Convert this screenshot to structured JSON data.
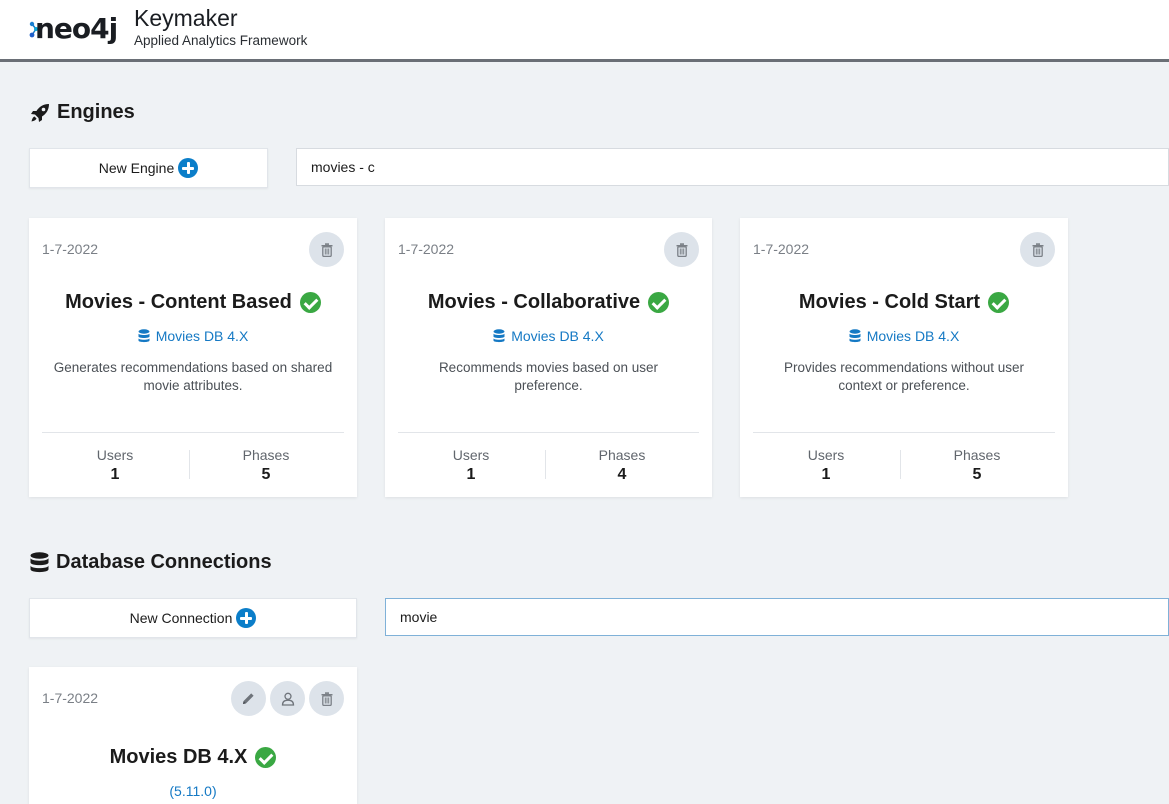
{
  "header": {
    "logo_text": "neo4j",
    "app_title": "Keymaker",
    "app_subtitle": "Applied Analytics Framework"
  },
  "engines": {
    "section_title": "Engines",
    "section_icon": "rocket-icon",
    "new_label": "New Engine",
    "search_value": "movies - c",
    "cards": [
      {
        "date": "1-7-2022",
        "title": "Movies - Content Based",
        "db": "Movies DB 4.X",
        "description": "Generates recommendations based on shared movie attributes.",
        "users_label": "Users",
        "users": "1",
        "phases_label": "Phases",
        "phases": "5"
      },
      {
        "date": "1-7-2022",
        "title": "Movies - Collaborative",
        "db": "Movies DB 4.X",
        "description": "Recommends movies based on user preference.",
        "users_label": "Users",
        "users": "1",
        "phases_label": "Phases",
        "phases": "4"
      },
      {
        "date": "1-7-2022",
        "title": "Movies - Cold Start",
        "db": "Movies DB 4.X",
        "description": "Provides recommendations without user context or preference.",
        "users_label": "Users",
        "users": "1",
        "phases_label": "Phases",
        "phases": "5"
      }
    ]
  },
  "connections": {
    "section_title": "Database Connections",
    "section_icon": "database-icon",
    "new_label": "New Connection",
    "search_value": "movie",
    "cards": [
      {
        "date": "1-7-2022",
        "title": "Movies DB 4.X",
        "version": "(5.11.0)"
      }
    ]
  },
  "colors": {
    "accent": "#0b7ec9",
    "link": "#1579c4",
    "success": "#3aa843",
    "background": "#eff2f5"
  }
}
